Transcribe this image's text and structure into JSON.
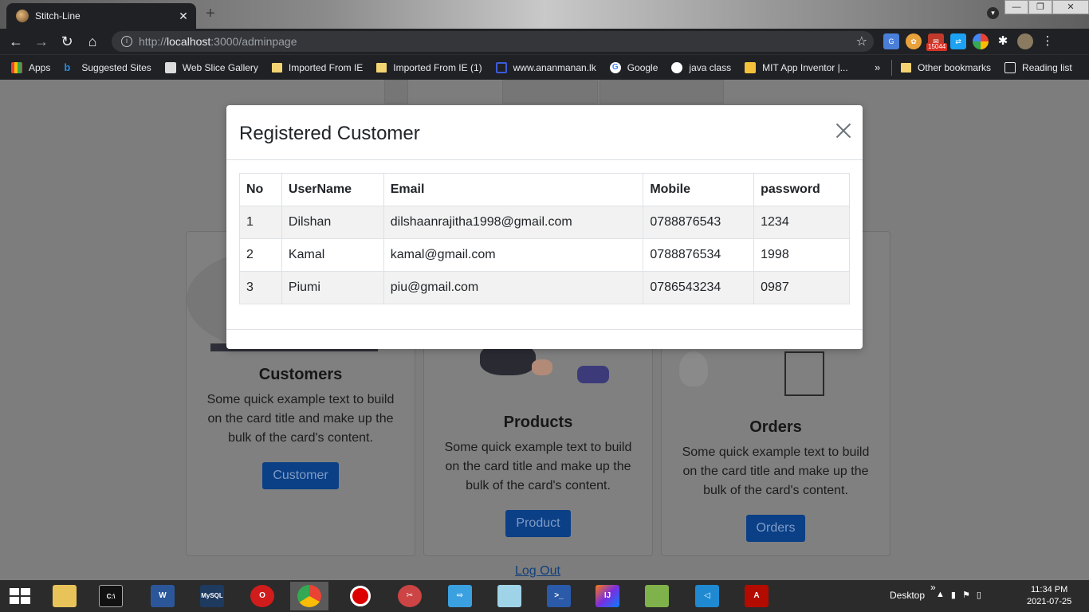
{
  "browser": {
    "tab_title": "Stitch-Line",
    "tab_close": "✕",
    "new_tab": "+",
    "url_proto": "http://",
    "url_host": "localhost",
    "url_path": ":3000/adminpage",
    "mail_badge": "15044",
    "window_controls": {
      "minimize": "—",
      "restore": "❐",
      "close": "✕"
    }
  },
  "bookmarks": {
    "items": [
      "Apps",
      "Suggested Sites",
      "Web Slice Gallery",
      "Imported From IE",
      "Imported From IE (1)",
      "www.ananmanan.lk",
      "Google",
      "java class",
      "MIT App Inventor |..."
    ],
    "more": "»",
    "other": "Other bookmarks",
    "reading_list": "Reading list"
  },
  "cards": [
    {
      "title": "Customers",
      "text": "Some quick example text to build on the card title and make up the bulk of the card's content.",
      "button": "Customer"
    },
    {
      "title": "Products",
      "text": "Some quick example text to build on the card title and make up the bulk of the card's content.",
      "button": "Product"
    },
    {
      "title": "Orders",
      "text": "Some quick example text to build on the card title and make up the bulk of the card's content.",
      "button": "Orders"
    }
  ],
  "logout_label": "Log Out",
  "modal": {
    "title": "Registered Customer",
    "columns": [
      "No",
      "UserName",
      "Email",
      "Mobile",
      "password"
    ],
    "rows": [
      [
        "1",
        "Dilshan",
        "dilshaanrajitha1998@gmail.com",
        "0788876543",
        "1234"
      ],
      [
        "2",
        "Kamal",
        "kamal@gmail.com",
        "0788876534",
        "1998"
      ],
      [
        "3",
        "Piumi",
        "piu@gmail.com",
        "0786543234",
        "0987"
      ]
    ]
  },
  "taskbar": {
    "desktop_label": "Desktop",
    "time": "11:34 PM",
    "date": "2021-07-25"
  }
}
